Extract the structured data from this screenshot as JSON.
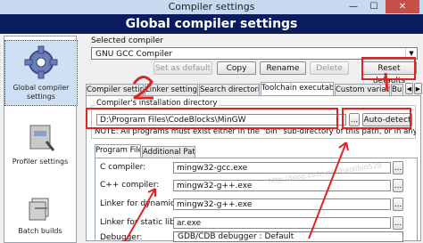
{
  "window": {
    "title": "Compiler settings"
  },
  "header": {
    "title": "Global compiler settings"
  },
  "left_panel": {
    "items": [
      {
        "label": "Global compiler settings",
        "icon": "gear-icon",
        "selected": true
      },
      {
        "label": "Profiler settings",
        "icon": "profiler-icon",
        "selected": false
      },
      {
        "label": "Batch builds",
        "icon": "batch-icon",
        "selected": false
      }
    ]
  },
  "selected_compiler": {
    "label": "Selected compiler",
    "value": "GNU GCC Compiler"
  },
  "buttons": {
    "set_default": "Set as default",
    "copy": "Copy",
    "rename": "Rename",
    "delete": "Delete",
    "reset_defaults": "Reset defaults"
  },
  "tabs": [
    {
      "label": "Compiler settings"
    },
    {
      "label": "Linker settings"
    },
    {
      "label": "Search directories"
    },
    {
      "label": "Toolchain executables",
      "active": true
    },
    {
      "label": "Custom variable"
    },
    {
      "label": "Bui"
    }
  ],
  "install_dir": {
    "group_label": "Compiler's installation directory",
    "value": "D:\\Program Files\\CodeBlocks\\MinGW",
    "browse": "...",
    "auto_detect": "Auto-detect",
    "note": "NOTE: All programs must exist either in the \"bin\" sub-directory of this path, or in any of the"
  },
  "subtabs": [
    {
      "label": "Program Files",
      "active": true
    },
    {
      "label": "Additional Paths"
    }
  ],
  "programs": [
    {
      "label": "C compiler:",
      "value": "mingw32-gcc.exe"
    },
    {
      "label": "C++ compiler:",
      "value": "mingw32-g++.exe"
    },
    {
      "label": "Linker for dynamic libs:",
      "value": "mingw32-g++.exe"
    },
    {
      "label": "Linker for static libs:",
      "value": "ar.exe"
    },
    {
      "label": "Debugger:",
      "value": "GDB/CDB debugger : Default"
    }
  ],
  "annotations": {
    "one": "1",
    "two": "2"
  },
  "watermark": "http://blog.csdn.net/haolibin528",
  "colors": {
    "header_bg": "#0b1c5e",
    "annotation_red": "#e02424",
    "close_button": "#c74f4a"
  }
}
